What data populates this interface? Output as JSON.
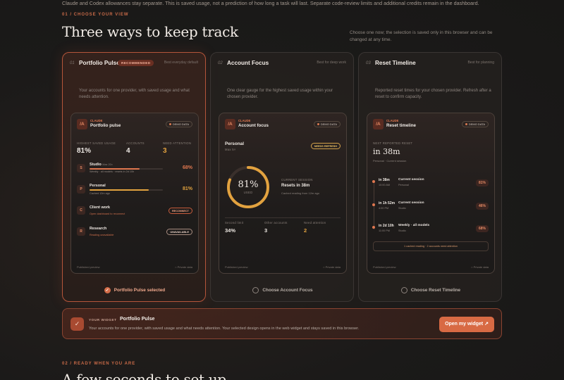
{
  "intro_text": "Claude and Codex allowances stay separate. This is saved usage, not a prediction of how long a task will last. Separate code-review limits and additional credits remain in the dashboard.",
  "section1": {
    "eyebrow": "01 / CHOOSE YOUR VIEW",
    "title": "Three ways to keep track",
    "note": "Choose one now; the selection is saved only in this browser and can be changed at any time."
  },
  "cards": [
    {
      "num": "01",
      "title": "Portfolio Pulse",
      "badge": "RECOMMENDED",
      "best": "Best everyday default",
      "desc": "Your accounts for one provider, with saved usage and what needs attention.",
      "choose": "Portfolio Pulse selected",
      "selected": true
    },
    {
      "num": "02",
      "title": "Account Focus",
      "best": "Best for deep work",
      "desc": "One clear gauge for the highest saved usage within your chosen provider.",
      "choose": "Choose Account Focus",
      "selected": false
    },
    {
      "num": "03",
      "title": "Reset Timeline",
      "best": "Best for planning",
      "desc": "Reported reset times for your chosen provider. Refresh after a reset to confirm capacity.",
      "choose": "Choose Reset Timeline",
      "selected": false
    }
  ],
  "preview_common": {
    "provider": "CLAUDE",
    "logo": "/A",
    "demo": "DEMO DATA",
    "foot_left": "Published preview",
    "foot_right": "Private data"
  },
  "pulse": {
    "title": "Portfolio pulse",
    "stats": [
      {
        "label": "HIGHEST SAVED USAGE",
        "value": "81%"
      },
      {
        "label": "ACCOUNTS",
        "value": "4"
      },
      {
        "label": "NEED ATTENTION",
        "value": "3"
      }
    ],
    "rows": [
      {
        "icon": "S",
        "name": "Studio",
        "tag": "Max 20×",
        "sub": "Weekly · all models · resets in 2d 10h",
        "pct": "68%",
        "fill": 0.68,
        "color": "#e0774f"
      },
      {
        "icon": "P",
        "name": "Personal",
        "sub": "Cached 12m ago",
        "pct": "81%",
        "fill": 0.81,
        "color": "#e2a23f"
      },
      {
        "icon": "C",
        "name": "Client work",
        "sub": "Open dashboard to reconnect",
        "pill": "RECONNECT",
        "color": "#e0774f"
      },
      {
        "icon": "R",
        "name": "Research",
        "sub": "Reading unavailable",
        "pill": "UNAVAILABLE",
        "color": "#d7b7a8"
      }
    ]
  },
  "focus": {
    "title": "Account focus",
    "account": "Personal",
    "plan": "Max 5×",
    "pill": "NEEDS REFRESH",
    "gauge": {
      "value": "81%",
      "label": "USED",
      "fill": 0.81
    },
    "session_label": "CURRENT SESSION",
    "session_value": "Resets in 38m",
    "session_sub": "Cached reading from 12m ago",
    "stats": [
      {
        "label": "Second limit",
        "value": "34%"
      },
      {
        "label": "Other accounts",
        "value": "3"
      },
      {
        "label": "Need attention",
        "value": "2"
      }
    ]
  },
  "timeline": {
    "title": "Reset timeline",
    "next_label": "NEXT REPORTED RESET",
    "next_value": "in 38m",
    "next_sub": "Personal · Current session",
    "items": [
      {
        "time": "in 38m",
        "sub": "10:00 AM",
        "name": "Current session",
        "acct": "Personal",
        "pct": "81%"
      },
      {
        "time": "in 1h 52m",
        "sub": "4:00 PM",
        "name": "Current session",
        "acct": "Studio",
        "pct": "46%"
      },
      {
        "time": "in 2d 10h",
        "sub": "11:00 PM",
        "name": "Weekly · all models",
        "acct": "Studio",
        "pct": "68%"
      }
    ],
    "footer": "1 cached reading · 2 accounts need attention"
  },
  "banner": {
    "label": "YOUR WIDGET",
    "title": "Portfolio Pulse",
    "desc": "Your accounts for one provider, with saved usage and what needs attention. Your selected design opens in the web widget and stays saved in this browser.",
    "cta": "Open my widget ↗"
  },
  "section2": {
    "eyebrow": "02 / READY WHEN YOU ARE",
    "title": "A few seconds to set up"
  }
}
